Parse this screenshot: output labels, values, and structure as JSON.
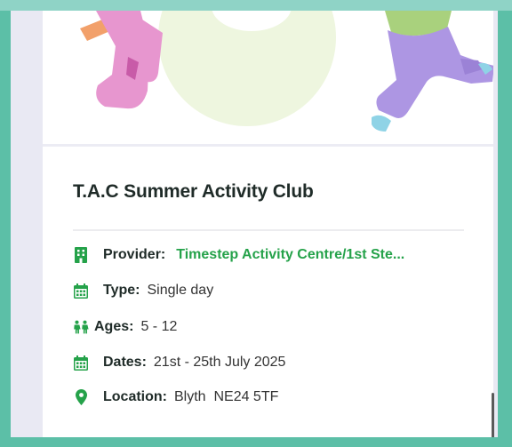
{
  "activity": {
    "title": "T.A.C Summer Activity Club"
  },
  "details": {
    "provider": {
      "label": "Provider:",
      "value": "Timestep Activity Centre/1st Ste...",
      "icon": "building-icon"
    },
    "type": {
      "label": "Type:",
      "value": "Single day",
      "icon": "calendar-icon"
    },
    "ages": {
      "label": "Ages:",
      "value": "5 - 12",
      "icon": "children-icon"
    },
    "dates": {
      "label": "Dates:",
      "value": "21st - 25th July 2025",
      "icon": "calendar-icon"
    },
    "location": {
      "label": "Location:",
      "value": "Blyth  NE24 5TF",
      "icon": "map-pin-icon"
    }
  },
  "colors": {
    "accent_green": "#25a24a",
    "frame_teal": "#5cbfa7",
    "title_text": "#1f2b28"
  }
}
